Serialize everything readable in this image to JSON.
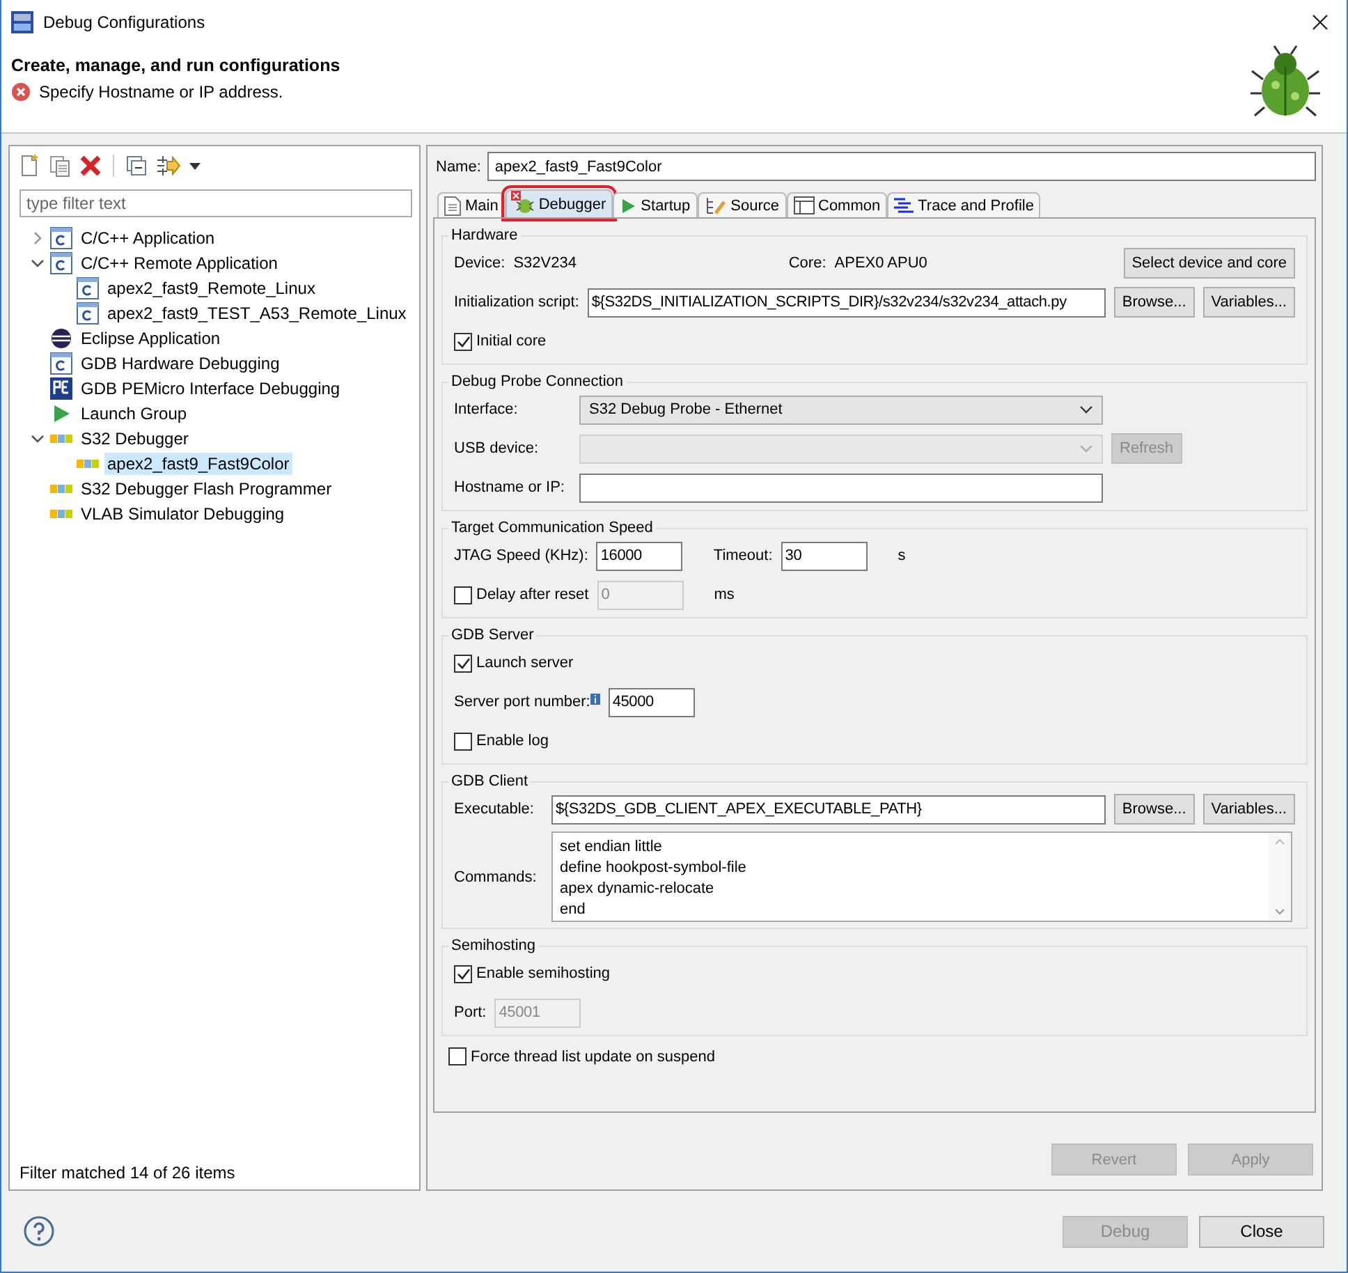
{
  "window": {
    "title": "Debug Configurations"
  },
  "header": {
    "title": "Create, manage, and run configurations",
    "message": "Specify Hostname or IP address."
  },
  "filter": {
    "placeholder": "type filter text"
  },
  "tree": [
    {
      "label": "C/C++ Application",
      "kind": "c",
      "expanded": false,
      "selected": false
    },
    {
      "label": "C/C++ Remote Application",
      "kind": "c",
      "expanded": true,
      "selected": false,
      "children": [
        {
          "label": "apex2_fast9_Remote_Linux",
          "kind": "c",
          "selected": false
        },
        {
          "label": "apex2_fast9_TEST_A53_Remote_Linux",
          "kind": "c",
          "selected": false
        }
      ]
    },
    {
      "label": "Eclipse Application",
      "kind": "eclipse",
      "selected": false
    },
    {
      "label": "GDB Hardware Debugging",
      "kind": "c",
      "selected": false
    },
    {
      "label": "GDB PEMicro Interface Debugging",
      "kind": "pemicro",
      "selected": false
    },
    {
      "label": "Launch Group",
      "kind": "launch",
      "selected": false
    },
    {
      "label": "S32 Debugger",
      "kind": "nxp",
      "expanded": true,
      "selected": false,
      "children": [
        {
          "label": "apex2_fast9_Fast9Color",
          "kind": "nxp",
          "selected": true
        }
      ]
    },
    {
      "label": "S32 Debugger Flash Programmer",
      "kind": "nxp",
      "selected": false
    },
    {
      "label": "VLAB Simulator Debugging",
      "kind": "nxp",
      "selected": false
    }
  ],
  "filter_status": "Filter matched 14 of 26 items",
  "name": {
    "label": "Name:",
    "value": "apex2_fast9_Fast9Color"
  },
  "tabs": [
    {
      "label": "Main",
      "kind": "main",
      "selected": false,
      "error": false,
      "highlighted": false
    },
    {
      "label": "Debugger",
      "kind": "debugger",
      "selected": true,
      "error": true,
      "highlighted": true
    },
    {
      "label": "Startup",
      "kind": "startup",
      "selected": false,
      "error": false,
      "highlighted": false
    },
    {
      "label": "Source",
      "kind": "source",
      "selected": false,
      "error": false,
      "highlighted": false
    },
    {
      "label": "Common",
      "kind": "common",
      "selected": false,
      "error": false,
      "highlighted": false
    },
    {
      "label": "Trace and Profile",
      "kind": "trace",
      "selected": false,
      "error": false,
      "highlighted": false
    }
  ],
  "groups": [
    {
      "title": "Hardware",
      "rows": [
        [
          {
            "kind": "pair",
            "label": "Device:",
            "value": "S32V234"
          },
          {
            "kind": "pair",
            "label": "Core:",
            "value": "APEX0 APU0"
          },
          {
            "kind": "button",
            "label": "Select device and core",
            "disabled": false
          }
        ],
        [
          {
            "kind": "text",
            "text": "Initialization script:"
          },
          {
            "kind": "field",
            "value": "${S32DS_INITIALIZATION_SCRIPTS_DIR}/s32v234/s32v234_attach.py",
            "disabled": false
          },
          {
            "kind": "button",
            "label": "Browse...",
            "disabled": false
          },
          {
            "kind": "button",
            "label": "Variables...",
            "disabled": false
          }
        ],
        [
          {
            "kind": "checkbox",
            "label": "Initial core",
            "checked": true
          }
        ]
      ]
    },
    {
      "title": "Debug Probe Connection",
      "rows": [
        [
          {
            "kind": "wide-label",
            "text": "Interface:"
          },
          {
            "kind": "dropdown",
            "value": "S32 Debug Probe - Ethernet",
            "disabled": false
          }
        ],
        [
          {
            "kind": "wide-label",
            "text": "USB device:"
          },
          {
            "kind": "dropdown",
            "disabled": true
          },
          {
            "kind": "button",
            "label": "Refresh",
            "disabled": true
          }
        ],
        [
          {
            "kind": "wide-label",
            "text": "Hostname or IP:"
          },
          {
            "kind": "medium-field",
            "disabled": false
          }
        ]
      ]
    },
    {
      "title": "Target Communication Speed",
      "rows": [
        [
          {
            "kind": "text",
            "text": "JTAG Speed (KHz):"
          },
          {
            "kind": "short-field",
            "value": "16000",
            "disabled": false
          },
          {
            "kind": "text",
            "text": "Timeout:"
          },
          {
            "kind": "short-field",
            "value": "30",
            "disabled": false
          },
          {
            "kind": "text",
            "text": "s"
          }
        ],
        [
          {
            "kind": "checkbox",
            "label": "Delay after reset",
            "checked": false
          },
          {
            "kind": "short-field",
            "value": "0",
            "disabled": true
          },
          {
            "kind": "text",
            "text": "ms"
          }
        ]
      ]
    },
    {
      "title": "GDB Server",
      "rows": [
        [
          {
            "kind": "checkbox",
            "label": "Launch server",
            "checked": true
          }
        ],
        [
          {
            "kind": "info-label",
            "text": "Server port number:"
          },
          {
            "kind": "short-field",
            "value": "45000",
            "disabled": false
          }
        ],
        [
          {
            "kind": "checkbox",
            "label": "Enable log",
            "checked": false
          }
        ]
      ]
    },
    {
      "title": "GDB Client",
      "rows": [
        [
          {
            "kind": "label",
            "text": "Executable:"
          },
          {
            "kind": "field",
            "value": "${S32DS_GDB_CLIENT_APEX_EXECUTABLE_PATH}",
            "disabled": false
          },
          {
            "kind": "button",
            "label": "Browse...",
            "disabled": false
          },
          {
            "kind": "button",
            "label": "Variables...",
            "disabled": false
          }
        ],
        [
          {
            "kind": "label",
            "text": "Commands:"
          },
          {
            "kind": "commands",
            "lines": [
              "set endian little",
              "define hookpost-symbol-file",
              "apex dynamic-relocate",
              "end"
            ]
          }
        ]
      ]
    },
    {
      "title": "Semihosting",
      "rows": [
        [
          {
            "kind": "checkbox",
            "label": "Enable semihosting",
            "checked": true
          }
        ],
        [
          {
            "kind": "text",
            "text": "Port:"
          },
          {
            "kind": "short-field",
            "value": "45001",
            "disabled": true
          }
        ]
      ]
    }
  ],
  "force_update": {
    "label": "Force thread list update on suspend",
    "checked": false
  },
  "panel_buttons": [
    {
      "label": "Revert",
      "disabled": true
    },
    {
      "label": "Apply",
      "disabled": true
    }
  ],
  "dialog_buttons": [
    {
      "label": "Debug",
      "disabled": true
    },
    {
      "label": "Close",
      "disabled": false
    }
  ]
}
